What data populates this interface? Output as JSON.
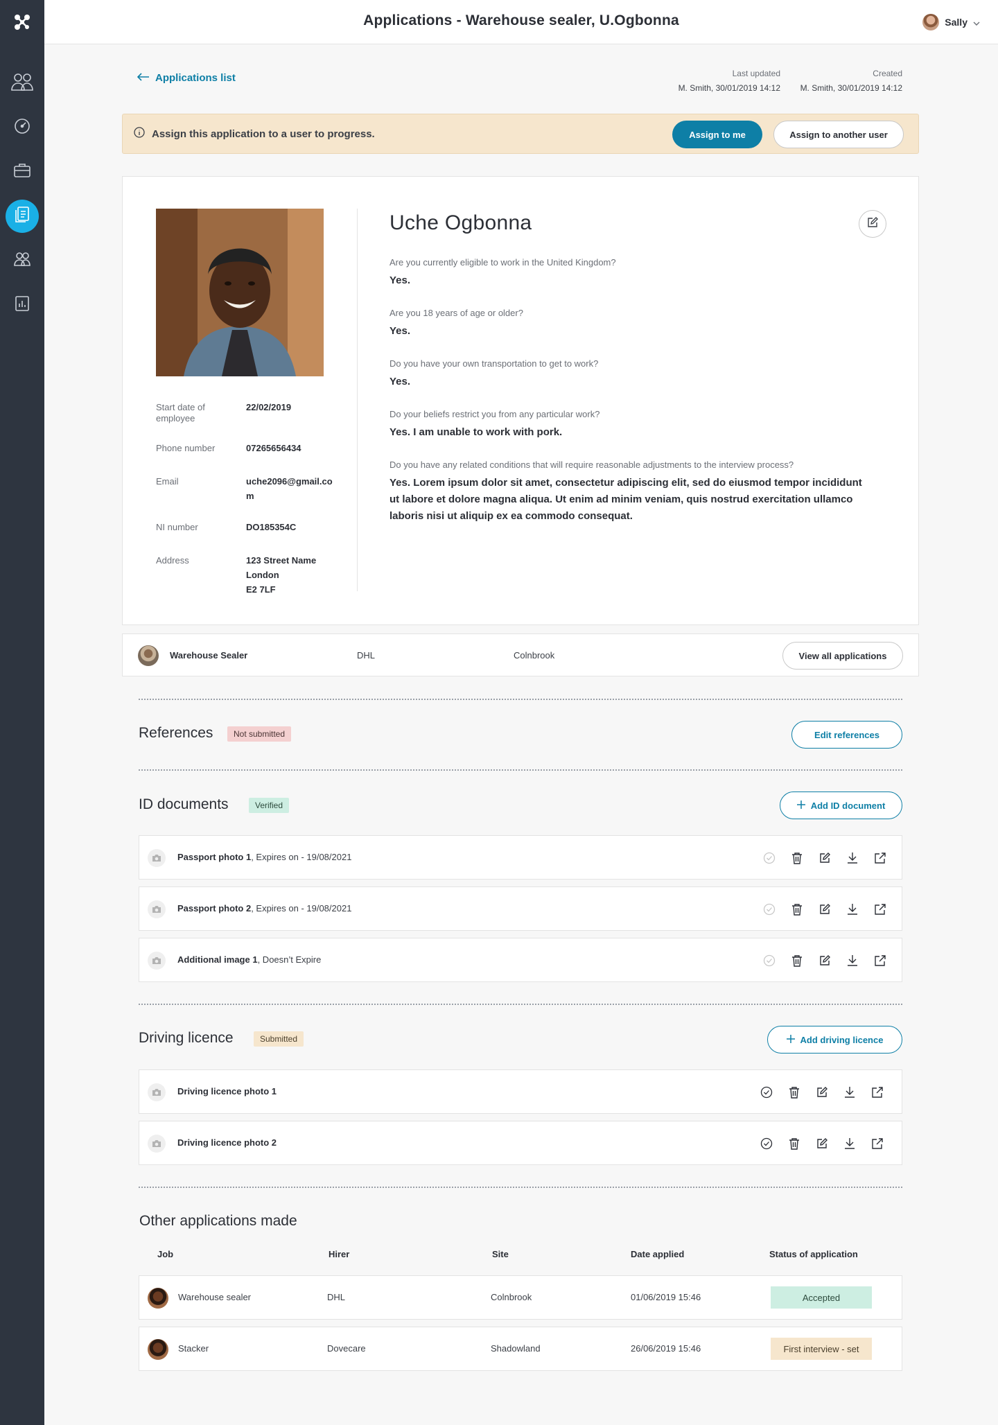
{
  "colors": {
    "sidebar": "#2e3540",
    "accent": "#0e7fa6",
    "active_nav": "#1ab0e6",
    "banner_bg": "#f6e6cd",
    "verified": "#cdeee2",
    "not_submitted": "#f4d0d0",
    "submitted": "#f6e6cd"
  },
  "sidebar": {
    "items": [
      {
        "icon": "people-icon"
      },
      {
        "icon": "dashboard-icon"
      },
      {
        "icon": "briefcase-icon"
      },
      {
        "icon": "documents-icon",
        "active": true
      },
      {
        "icon": "users-icon"
      },
      {
        "icon": "reports-icon"
      }
    ]
  },
  "header": {
    "title": "Applications - Warehouse sealer, U.Ogbonna",
    "user_name": "Sally"
  },
  "back_link": "Applications list",
  "meta": {
    "last_updated_label": "Last updated",
    "last_updated_value": "M. Smith, 30/01/2019 14:12",
    "created_label": "Created",
    "created_value": "M. Smith, 30/01/2019 14:12"
  },
  "banner": {
    "text": "Assign this application to a user to progress.",
    "assign_me": "Assign to me",
    "assign_other": "Assign to another user"
  },
  "profile": {
    "name": "Uche Ogbonna",
    "details": [
      {
        "label": "Start date of employee",
        "value": "22/02/2019"
      },
      {
        "label": "Phone number",
        "value": "07265656434"
      },
      {
        "label": "Email",
        "value": "uche2096@gmail.com"
      },
      {
        "label": "NI number",
        "value": "DO185354C"
      },
      {
        "label": "Address",
        "value_lines": [
          "123 Street Name",
          "London",
          "E2 7LF"
        ]
      }
    ],
    "questions": [
      {
        "q": "Are you currently eligible to work in the United Kingdom?",
        "a": "Yes."
      },
      {
        "q": "Are you 18 years of age or older?",
        "a": "Yes."
      },
      {
        "q": "Do you have your own transportation to get to work?",
        "a": "Yes."
      },
      {
        "q": "Do your beliefs restrict you from any particular work?",
        "a": "Yes. I am unable to work with pork."
      },
      {
        "q": "Do you have any related conditions that will require reasonable adjustments to the interview process?",
        "a": "Yes. Lorem ipsum dolor sit amet, consectetur adipiscing elit, sed do eiusmod tempor incididunt ut labore et dolore magna aliqua. Ut enim ad minim veniam, quis nostrud exercitation ullamco laboris nisi ut aliquip ex ea commodo consequat."
      }
    ]
  },
  "job": {
    "title": "Warehouse Sealer",
    "hirer": "DHL",
    "site": "Colnbrook",
    "view_all": "View all applications"
  },
  "references": {
    "title": "References",
    "status": "Not submitted",
    "button": "Edit references"
  },
  "id_documents": {
    "title": "ID documents",
    "status": "Verified",
    "button": "Add ID document",
    "items": [
      {
        "name": "Passport photo 1",
        "detail": ", Expires on - 19/08/2021"
      },
      {
        "name": "Passport photo 2",
        "detail": ", Expires on - 19/08/2021"
      },
      {
        "name": "Additional image 1",
        "detail": ", Doesn’t Expire"
      }
    ]
  },
  "driving_licence": {
    "title": "Driving licence",
    "status": "Submitted",
    "button": "Add driving licence",
    "items": [
      {
        "name": "Driving licence photo 1",
        "detail": ""
      },
      {
        "name": "Driving licence photo 2",
        "detail": ""
      }
    ]
  },
  "other_applications": {
    "title": "Other applications made",
    "columns": [
      "Job",
      "Hirer",
      "Site",
      "Date applied",
      "Status of application"
    ],
    "rows": [
      {
        "job": "Warehouse sealer",
        "hirer": "DHL",
        "site": "Colnbrook",
        "date": "01/06/2019 15:46",
        "status": "Accepted"
      },
      {
        "job": "Stacker",
        "hirer": "Dovecare",
        "site": "Shadowland",
        "date": "26/06/2019 15:46",
        "status": "First interview - set"
      }
    ]
  }
}
